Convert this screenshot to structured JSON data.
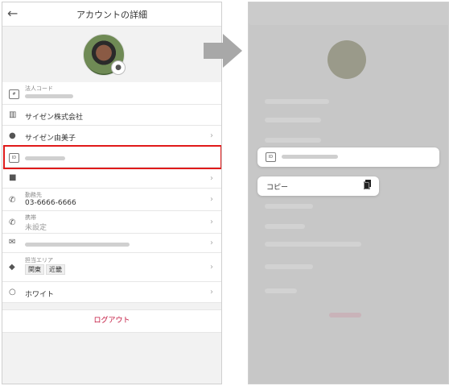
{
  "left": {
    "title": "アカウントの詳細",
    "back_icon": "arrow-left-icon",
    "rows": {
      "corp_code_label": "法人コード",
      "company": "サイゼン株式会社",
      "user_name": "サイゼン由美子",
      "work_label": "勤務先",
      "work_phone": "03-6666-6666",
      "mobile_label": "携帯",
      "mobile_value": "未設定",
      "area_label": "担当エリア",
      "area_tags": [
        "関東",
        "近畿"
      ],
      "white": "ホワイト"
    },
    "logout": "ログアウト",
    "highlight_color": "#e01a1a",
    "accent_color": "#c2143d"
  },
  "right": {
    "copy_label": "コピー"
  }
}
